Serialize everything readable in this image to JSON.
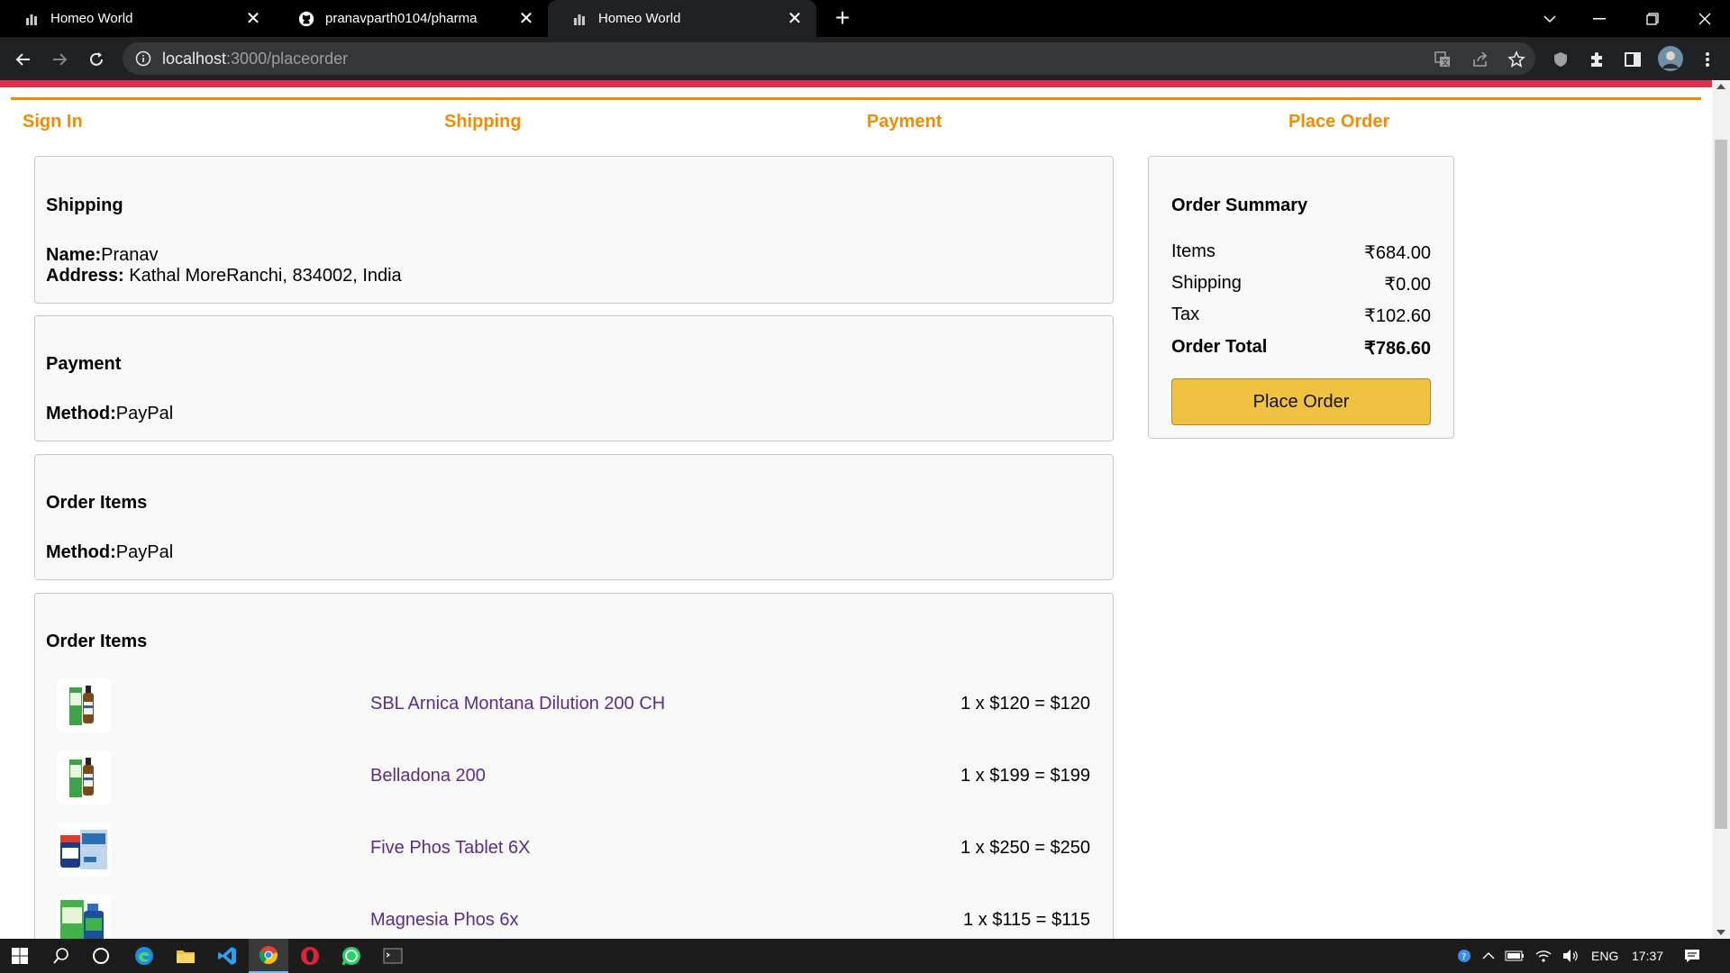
{
  "browser": {
    "tabs": [
      {
        "title": "Homeo World",
        "icon": "bars-icon",
        "active": false
      },
      {
        "title": "pranavparth0104/pharma",
        "icon": "github-icon",
        "active": false
      },
      {
        "title": "Homeo World",
        "icon": "bars-icon",
        "active": true
      }
    ],
    "url_host": "localhost",
    "url_path": ":3000/placeorder"
  },
  "checkout_steps": [
    "Sign In",
    "Shipping",
    "Payment",
    "Place Order"
  ],
  "shipping": {
    "heading": "Shipping",
    "name_label": "Name:",
    "name_value": "Pranav",
    "address_label": "Address:",
    "address_value": " Kathal MoreRanchi, 834002, India"
  },
  "payment": {
    "heading": "Payment",
    "method_label": "Method:",
    "method_value": "PayPal"
  },
  "order_items_method": {
    "heading": "Order Items",
    "method_label": "Method:",
    "method_value": "PayPal"
  },
  "order_items": {
    "heading": "Order Items",
    "items": [
      {
        "name": "SBL Arnica Montana Dilution 200 CH",
        "price": "1 x $120 = $120"
      },
      {
        "name": "Belladona 200",
        "price": "1 x $199 = $199"
      },
      {
        "name": "Five Phos Tablet 6X",
        "price": "1 x $250 = $250"
      },
      {
        "name": "Magnesia Phos 6x",
        "price": "1 x $115 = $115"
      }
    ]
  },
  "summary": {
    "heading": "Order Summary",
    "rows": [
      {
        "label": "Items",
        "value": "₹684.00"
      },
      {
        "label": "Shipping",
        "value": "₹0.00"
      },
      {
        "label": "Tax",
        "value": "₹102.60"
      },
      {
        "label": "Order Total",
        "value": "₹786.60"
      }
    ],
    "button_label": "Place Order"
  },
  "taskbar": {
    "language": "ENG",
    "time": "17:37"
  },
  "colors": {
    "accent_orange": "#f08c00",
    "top_bar_red": "#e1314a",
    "product_link": "#5a2d8a",
    "button_yellow": "#f0c040"
  }
}
